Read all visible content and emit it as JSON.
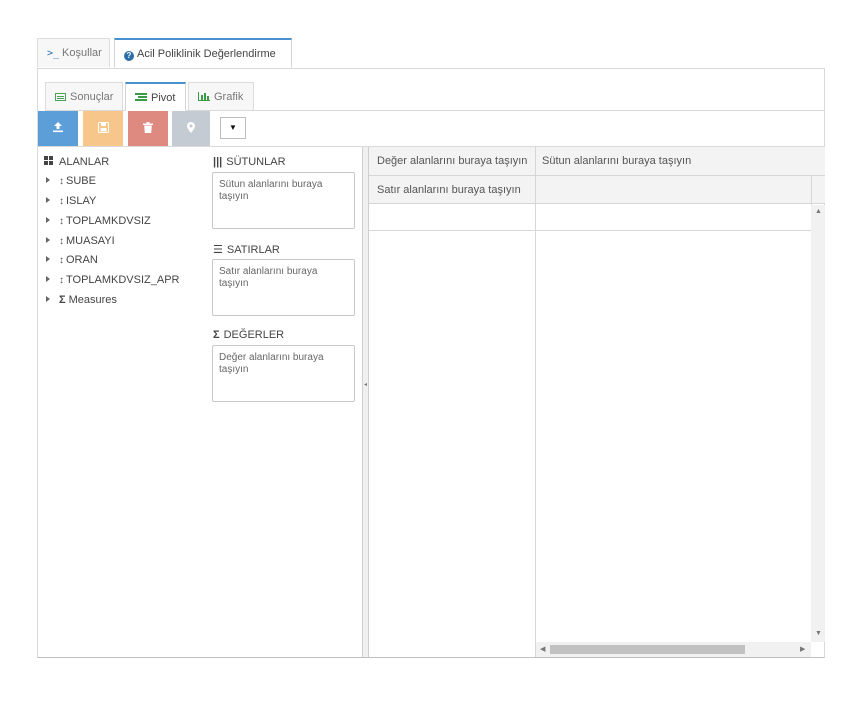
{
  "top_tabs": {
    "conditions": "Koşullar",
    "report": "Acil Poliklinik Değerlendirme"
  },
  "sub_tabs": {
    "results": "Sonuçlar",
    "pivot": "Pivot",
    "chart": "Grafik"
  },
  "toolbar": {
    "dropdown_glyph": "▼"
  },
  "fields": {
    "title": "ALANLAR",
    "items": [
      "SUBE",
      "ISLAY",
      "TOPLAMKDVSIZ",
      "MUASAYI",
      "ORAN",
      "TOPLAMKDVSIZ_APR"
    ],
    "measures": "Measures"
  },
  "zones": {
    "columns_title": "SÜTUNLAR",
    "columns_placeholder": "Sütun alanlarını buraya taşıyın",
    "rows_title": "SATIRLAR",
    "rows_placeholder": "Satır alanlarını buraya taşıyın",
    "values_title": "DEĞERLER",
    "values_placeholder": "Değer alanlarını buraya taşıyın"
  },
  "grid": {
    "values_header": "Değer alanlarını buraya taşıyın",
    "columns_header": "Sütun alanlarını buraya taşıyın",
    "rows_header": "Satır alanlarını buraya taşıyın"
  },
  "colors": {
    "accent": "#4a91d0",
    "upload": "#5c9fd8",
    "save": "#f6c68a",
    "delete": "#df8a80",
    "pin": "#c5cbd2"
  }
}
